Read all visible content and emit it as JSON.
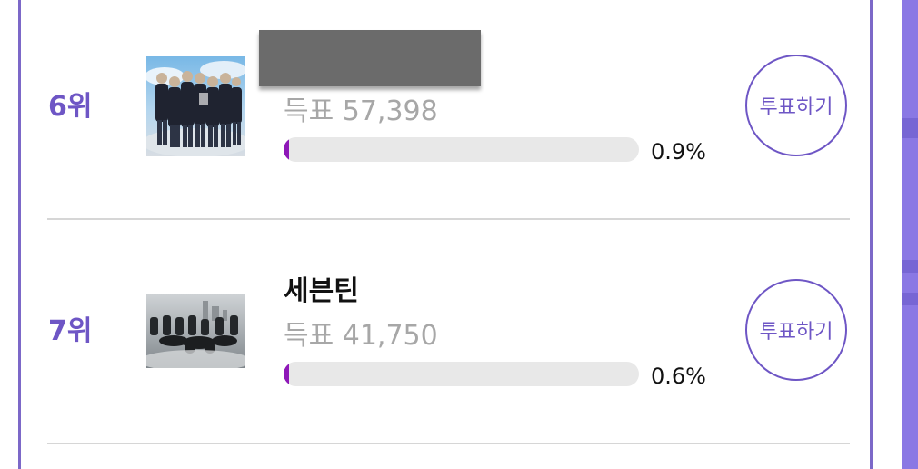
{
  "ranking": [
    {
      "rank": "6위",
      "name": "",
      "name_redacted": true,
      "votes": "득표 57,398",
      "percent_label": "0.9%",
      "percent": 0.9,
      "button_label": "투표하기"
    },
    {
      "rank": "7위",
      "name": "세븐틴",
      "name_redacted": false,
      "votes": "득표 41,750",
      "percent_label": "0.6%",
      "percent": 0.6,
      "button_label": "투표하기"
    }
  ],
  "colors": {
    "accent": "#6e56c5",
    "bar_fill": "#8e18b8",
    "bar_track": "#e8e8e8",
    "votes_text": "#a7a7a7",
    "side_strip": "#8a78e4"
  }
}
